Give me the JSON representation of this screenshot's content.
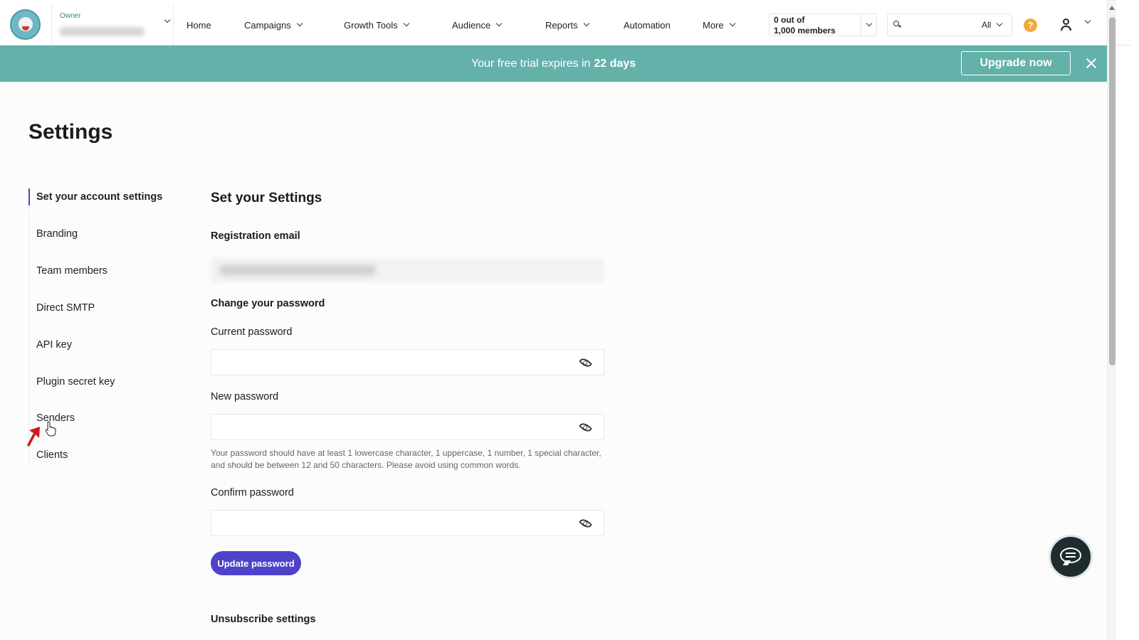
{
  "header": {
    "owner_label": "Owner",
    "nav": [
      {
        "label": "Home"
      },
      {
        "label": "Campaigns"
      },
      {
        "label": "Growth Tools"
      },
      {
        "label": "Audience"
      },
      {
        "label": "Reports"
      },
      {
        "label": "Automation"
      },
      {
        "label": "More"
      }
    ],
    "members_line1": "0 out of",
    "members_line2": "1,000 members",
    "search_placeholder": "",
    "search_filter": "All",
    "help_glyph": "?"
  },
  "banner": {
    "text": "Your free trial expires in",
    "days": "22 days",
    "upgrade_label": "Upgrade now"
  },
  "page": {
    "title": "Settings"
  },
  "sidebar": {
    "items": [
      {
        "label": "Set your account settings"
      },
      {
        "label": "Branding"
      },
      {
        "label": "Team members"
      },
      {
        "label": "Direct SMTP"
      },
      {
        "label": "API key"
      },
      {
        "label": "Plugin secret key"
      },
      {
        "label": "Senders"
      },
      {
        "label": "Clients"
      }
    ]
  },
  "main": {
    "section_title": "Set your Settings",
    "registration_email_label": "Registration email",
    "change_password_label": "Change your password",
    "current_password_label": "Current password",
    "new_password_label": "New password",
    "password_hint": "Your password should have at least 1 lowercase character, 1 uppercase, 1 number, 1 special character, and should be between 12 and 50 characters. Please avoid using common words.",
    "confirm_password_label": "Confirm password",
    "update_button": "Update password",
    "unsubscribe_label": "Unsubscribe settings"
  },
  "colors": {
    "banner": "#64b1a9",
    "accent": "#4d42c9",
    "help": "#f2a93b"
  },
  "icons": [
    "search-icon",
    "help-icon",
    "user-icon",
    "close-icon",
    "eye-icon",
    "chat-icon",
    "chevron-down-icon"
  ]
}
